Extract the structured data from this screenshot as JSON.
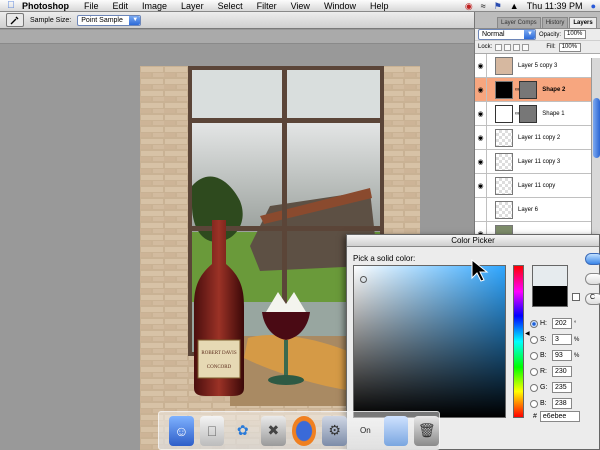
{
  "menubar": {
    "app_name": "Photoshop",
    "items": [
      "File",
      "Edit",
      "Image",
      "Layer",
      "Select",
      "Filter",
      "View",
      "Window",
      "Help"
    ],
    "clock": "Thu 11:39 PM"
  },
  "options_bar": {
    "sample_size_label": "Sample Size:",
    "sample_size_value": "Point Sample"
  },
  "layers_panel": {
    "tabs": [
      "Layer Comps",
      "History",
      "Layers"
    ],
    "active_tab": "Layers",
    "blend_mode": "Normal",
    "opacity_label": "Opacity:",
    "opacity_value": "100%",
    "lock_label": "Lock:",
    "fill_label": "Fill:",
    "fill_value": "100%",
    "layers": [
      {
        "name": "Layer 5 copy 3",
        "visible": true,
        "selected": false
      },
      {
        "name": "Shape 2",
        "visible": true,
        "selected": true
      },
      {
        "name": "Shape 1",
        "visible": true,
        "selected": false
      },
      {
        "name": "Layer 11 copy 2",
        "visible": true,
        "selected": false
      },
      {
        "name": "Layer 11 copy 3",
        "visible": true,
        "selected": false
      },
      {
        "name": "Layer 11 copy",
        "visible": true,
        "selected": false
      },
      {
        "name": "Layer 6",
        "visible": false,
        "selected": false
      }
    ]
  },
  "color_picker": {
    "title": "Color Picker",
    "prompt": "Pick a solid color:",
    "fields": [
      {
        "label": "H:",
        "value": "202",
        "unit": "°",
        "selected": true
      },
      {
        "label": "S:",
        "value": "3",
        "unit": "%",
        "selected": false
      },
      {
        "label": "B:",
        "value": "93",
        "unit": "%",
        "selected": false
      },
      {
        "label": "R:",
        "value": "230",
        "unit": "",
        "selected": false
      },
      {
        "label": "G:",
        "value": "235",
        "unit": "",
        "selected": false
      },
      {
        "label": "B:",
        "value": "238",
        "unit": "",
        "selected": false
      }
    ],
    "hex_label": "#",
    "hex_value": "e6ebee",
    "new_color": "#e6ebee",
    "old_color": "#000000"
  },
  "canvas": {
    "bottle_label_brand": "ROBERT DAVIS",
    "bottle_label_name": "CONCORD"
  },
  "dock": {
    "icons": [
      "finder-icon",
      "system-icon",
      "mail-icon",
      "tools-icon",
      "firefox-icon",
      "preferences-icon",
      "on-icon",
      "folder-icon",
      "trash-icon"
    ],
    "partial_label": "On"
  }
}
